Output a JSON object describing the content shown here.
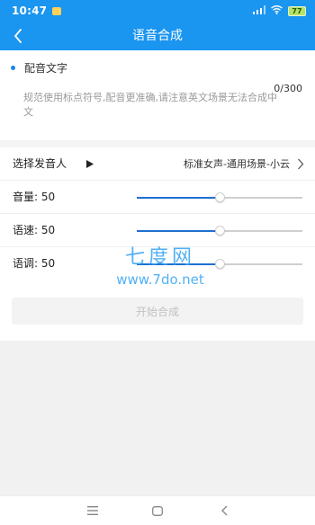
{
  "status_bar": {
    "time": "10:47",
    "battery": "77"
  },
  "header": {
    "title": "语音合成"
  },
  "dubbing": {
    "section_title": "配音文字",
    "counter": "0/300",
    "placeholder": "规范使用标点符号,配音更准确,请注意英文场景无法合成中文"
  },
  "speaker": {
    "label": "选择发音人",
    "value": "标准女声-通用场景-小云"
  },
  "sliders": [
    {
      "label": "音量: 50",
      "value": 50
    },
    {
      "label": "语速: 50",
      "value": 50
    },
    {
      "label": "语调: 50",
      "value": 50
    }
  ],
  "start_button": "开始合成",
  "watermark": {
    "brand": "七度网",
    "url": "www.7do.net"
  },
  "colors": {
    "primary": "#1a95f0",
    "slider_fill": "#1e6fd0"
  }
}
